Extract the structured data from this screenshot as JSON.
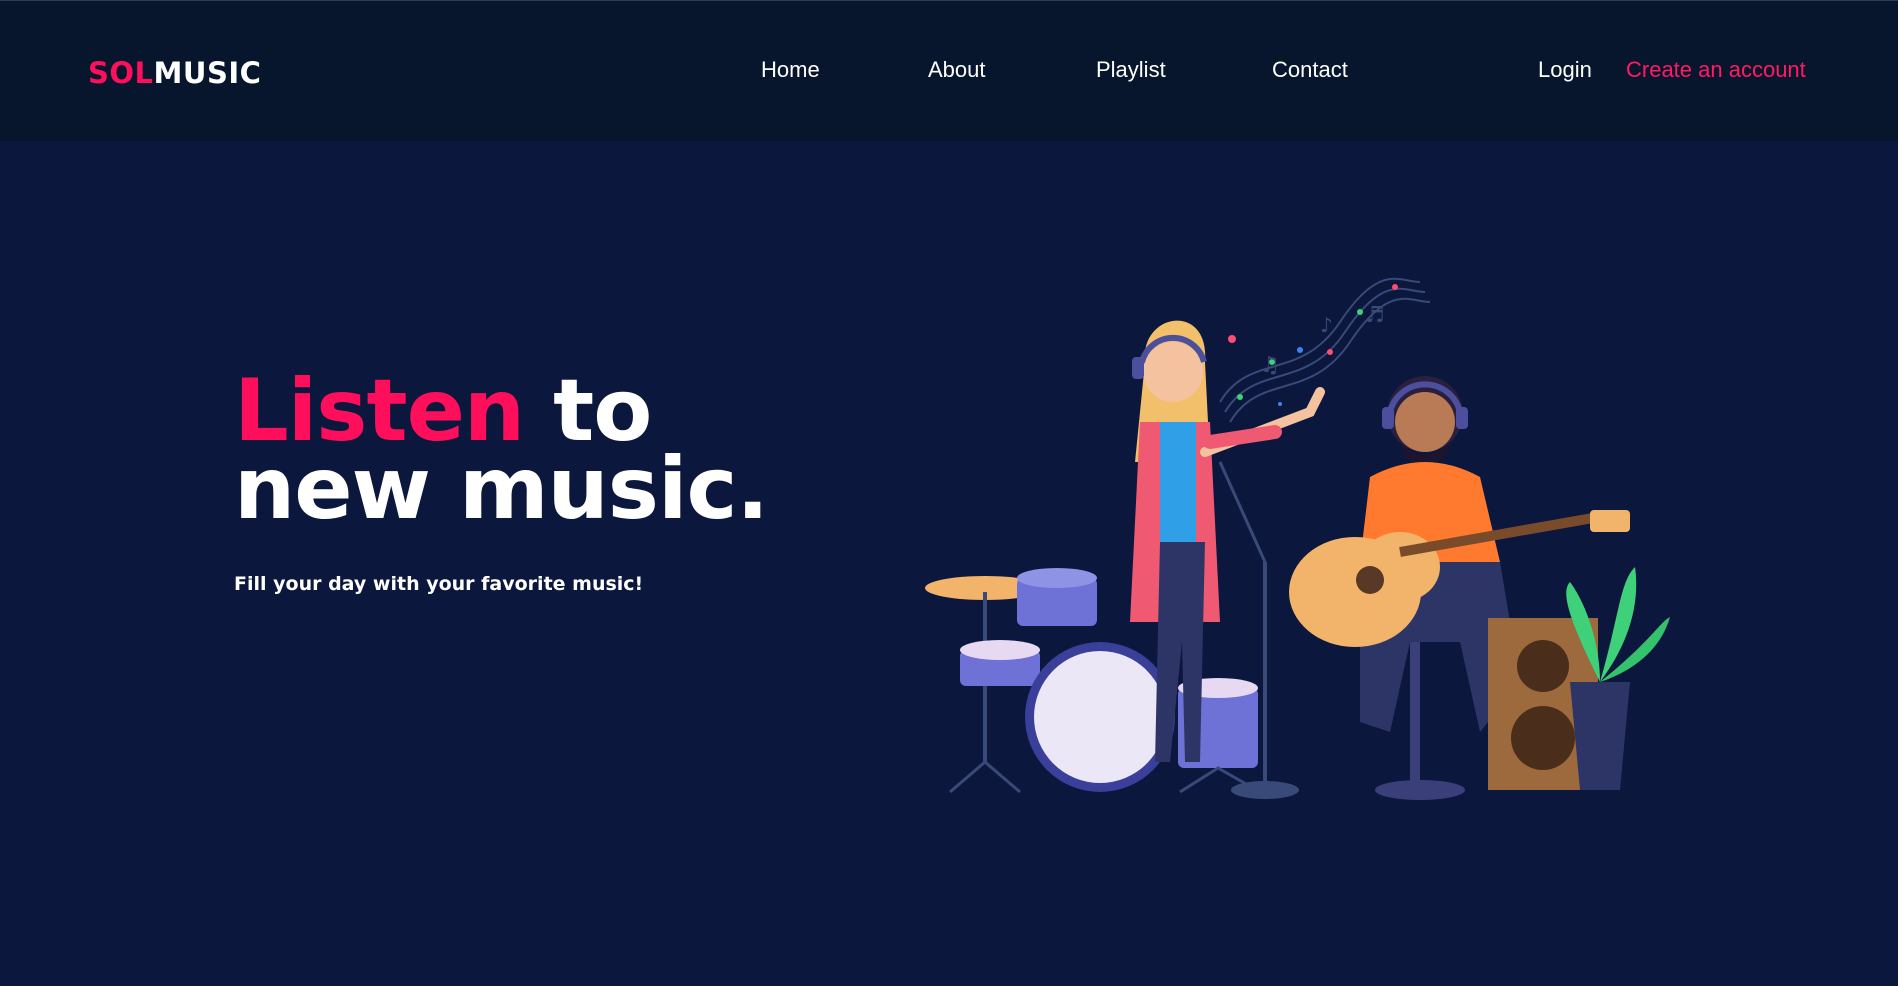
{
  "nav": {
    "logo_part1": "SOL",
    "logo_part2": "MUSIC",
    "links": [
      "Home",
      "About",
      "Playlist",
      "Contact"
    ],
    "login": "Login",
    "signup": "Create an account"
  },
  "hero": {
    "title_accent": "Listen",
    "title_rest_line1": " to",
    "title_line2": "new music.",
    "subtitle": "Fill your day with your favorite music!"
  },
  "colors": {
    "background": "#0b173c",
    "navbar": "#08162d",
    "accent": "#ff0f5b",
    "text": "#ffffff"
  },
  "illustration": {
    "description_icon": "band-performing-illustration"
  }
}
